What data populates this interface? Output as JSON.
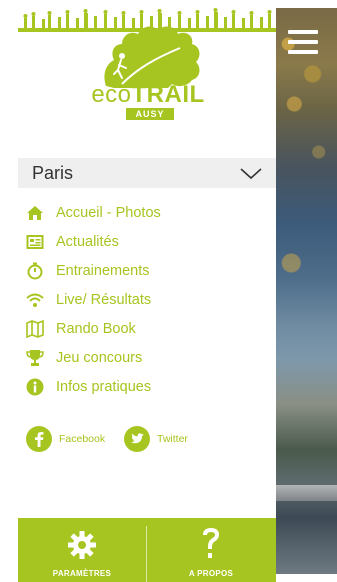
{
  "brand": {
    "logo_eco": "eco",
    "logo_trail": "TRAIL",
    "logo_sponsor": "AUSY"
  },
  "city_selector": {
    "value": "Paris"
  },
  "nav": {
    "items": [
      {
        "label": "Accueil - Photos",
        "icon": "home-icon"
      },
      {
        "label": "Actualités",
        "icon": "newspaper-icon"
      },
      {
        "label": "Entrainements",
        "icon": "stopwatch-icon"
      },
      {
        "label": "Live/ Résultats",
        "icon": "wifi-icon"
      },
      {
        "label": "Rando Book",
        "icon": "map-icon"
      },
      {
        "label": "Jeu concours",
        "icon": "trophy-icon"
      },
      {
        "label": "Infos pratiques",
        "icon": "info-icon"
      }
    ]
  },
  "social": {
    "facebook": "Facebook",
    "twitter": "Twitter"
  },
  "footer": {
    "settings": "PARAMÈTRES",
    "about": "A PROPOS"
  },
  "colors": {
    "accent": "#a7c520",
    "city_bar": "#efefef",
    "text_dark": "#333333"
  }
}
